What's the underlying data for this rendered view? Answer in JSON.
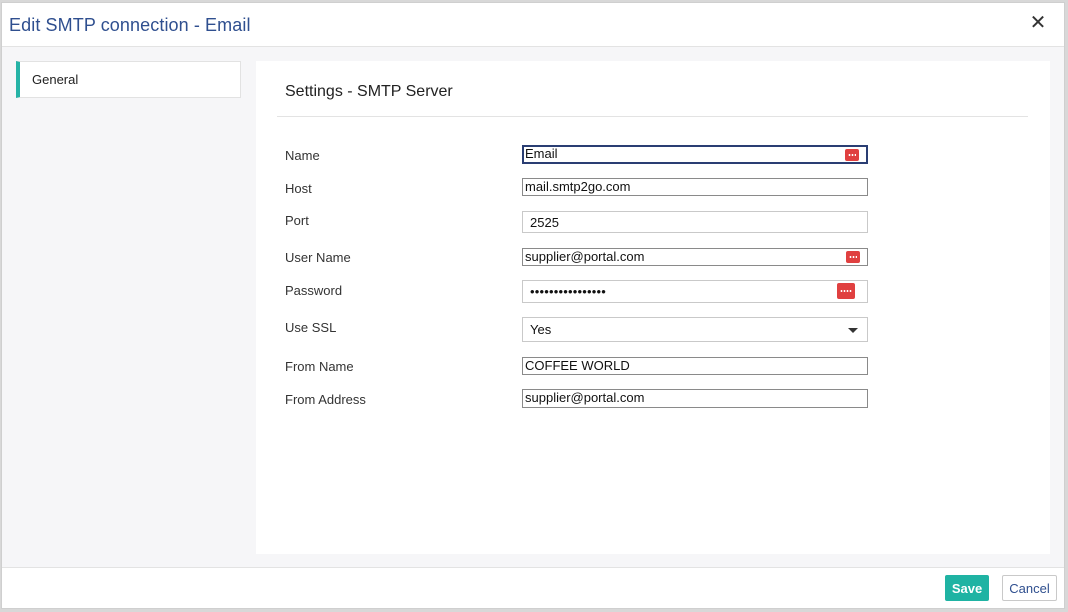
{
  "dialog": {
    "title": "Edit SMTP connection - Email",
    "close_icon": "close-icon"
  },
  "sidebar": {
    "items": [
      {
        "label": "General",
        "active": true
      }
    ]
  },
  "panel": {
    "title": "Settings - SMTP Server"
  },
  "form": {
    "name": {
      "label": "Name",
      "value": "Email"
    },
    "host": {
      "label": "Host",
      "value": "mail.smtp2go.com"
    },
    "port": {
      "label": "Port",
      "value": "2525"
    },
    "user_name": {
      "label": "User Name",
      "value": "supplier@portal.com"
    },
    "password": {
      "label": "Password",
      "value": "••••••••••••••••"
    },
    "use_ssl": {
      "label": "Use SSL",
      "value": "Yes"
    },
    "from_name": {
      "label": "From Name",
      "value": "COFFEE WORLD"
    },
    "from_address": {
      "label": "From Address",
      "value": "supplier@portal.com"
    }
  },
  "footer": {
    "save_label": "Save",
    "cancel_label": "Cancel"
  },
  "colors": {
    "accent": "#1fb3a3",
    "title_blue": "#2f4f8f",
    "password_manager_icon": "#e04040"
  }
}
